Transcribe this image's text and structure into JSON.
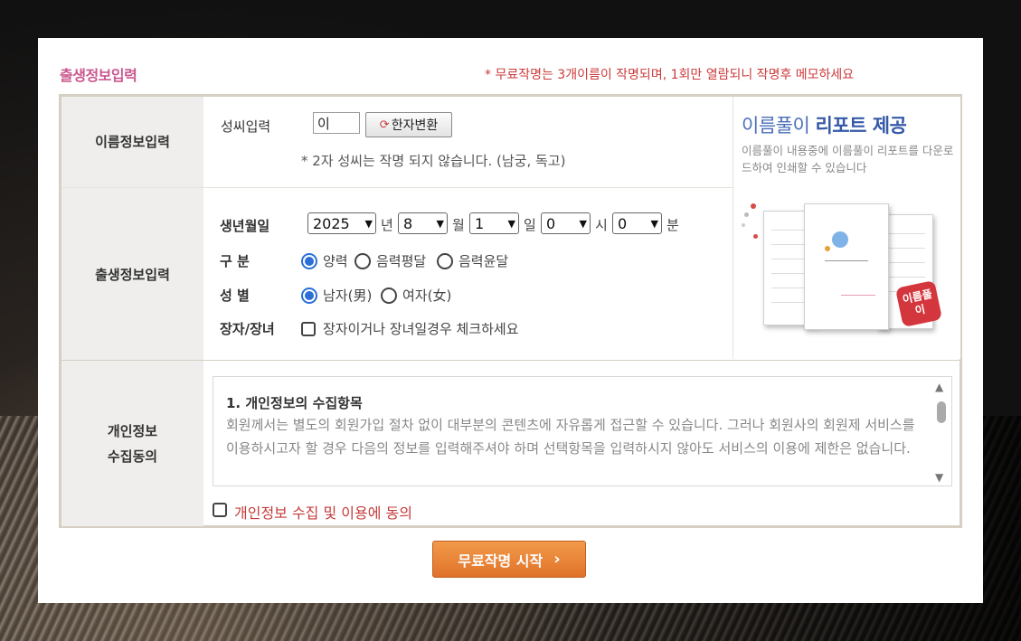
{
  "header": {
    "section_title": "출생정보입력",
    "notice": "* 무료작명는 3개이름이 작명되며, 1회만 열람되니 작명후 메모하세요"
  },
  "name_section": {
    "label": "이름정보입력",
    "surname_label": "성씨입력",
    "surname_value": "이",
    "hanja_button": "한자변환",
    "note": "* 2자 성씨는 작명 되지 않습니다. (남궁, 독고)"
  },
  "birth_section": {
    "label": "출생정보입력",
    "date_label": "생년월일",
    "year": "2025",
    "year_unit": "년",
    "month": "8",
    "month_unit": "월",
    "day": "1",
    "day_unit": "일",
    "hour": "0",
    "hour_unit": "시",
    "minute": "0",
    "minute_unit": "분",
    "calendar_label": "구 분",
    "calendar_options": [
      "양력",
      "음력평달",
      "음력윤달"
    ],
    "calendar_selected": "양력",
    "gender_label": "성 별",
    "gender_options": [
      "남자(男)",
      "여자(女)"
    ],
    "gender_selected": "남자(男)",
    "eldest_label": "장자/장녀",
    "eldest_checkbox": "장자이거나 장녀일경우 체크하세요"
  },
  "promo": {
    "title_plain": "이름풀이 ",
    "title_bold": "리포트 제공",
    "desc": "이름풀이 내용중에 이름풀이 리포트를 다운로드하여 인쇄할 수 있습니다",
    "badge": "이름풀이"
  },
  "privacy_section": {
    "label_line1": "개인정보",
    "label_line2": "수집동의",
    "heading": "1. 개인정보의 수집항목",
    "body": "회원께서는 별도의 회원가입 절차 없이 대부분의 콘텐츠에 자유롭게 접근할 수 있습니다. 그러나 회원사의 회원제 서비스를 이용하시고자 할 경우 다음의 정보를 입력해주셔야 하며 선택항목을 입력하시지 않아도 서비스의 이용에 제한은 없습니다.",
    "agree_label": "개인정보 수집 및 이용에 동의"
  },
  "actions": {
    "start_button": "무료작명 시작"
  },
  "colors": {
    "accent_pink": "#c9588f",
    "notice_red": "#cc3a3a",
    "radio_blue": "#2b6fd6",
    "button_orange": "#e0722a"
  }
}
